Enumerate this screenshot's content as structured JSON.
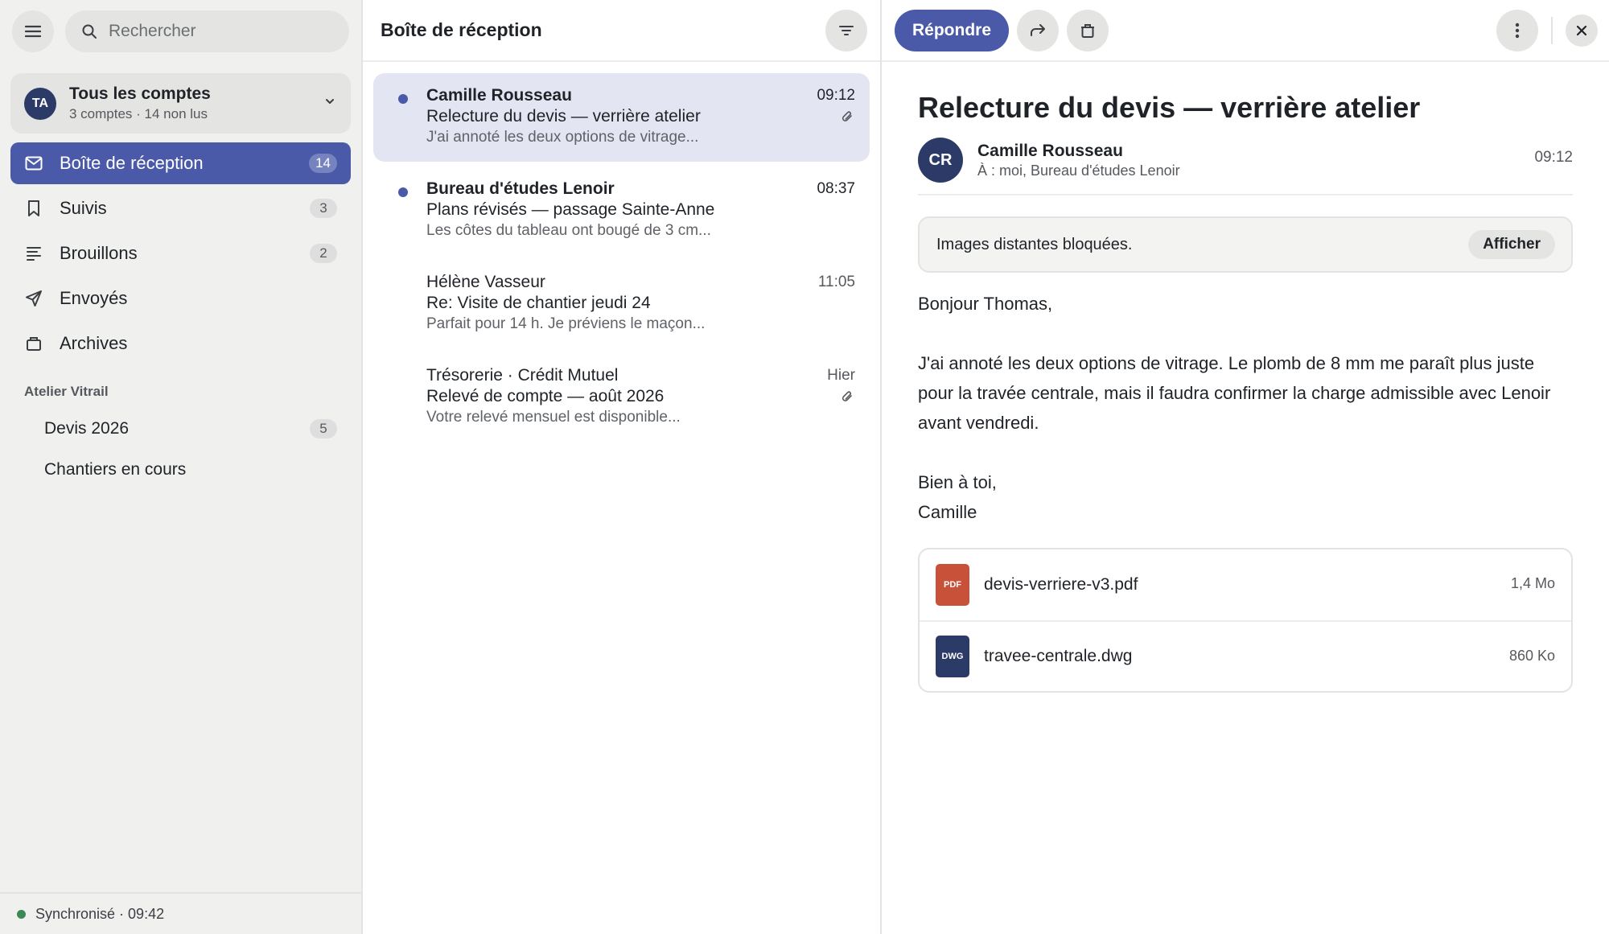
{
  "colors": {
    "accent": "#4a5aa8",
    "avatar": "#2b3a67",
    "sync_ok": "#3b8a55",
    "pdf": "#c8513a",
    "dwg": "#2b3a67"
  },
  "sidebar": {
    "search": {
      "placeholder": "Rechercher",
      "icon": "search-icon"
    },
    "menu_icon": "hamburger-icon",
    "account": {
      "initials": "TA",
      "name": "Tous les comptes",
      "subtitle": "3 comptes · 14 non lus"
    },
    "nav": [
      {
        "label": "Boîte de réception",
        "count": "14",
        "icon": "inbox-icon",
        "active": true
      },
      {
        "label": "Suivis",
        "count": "3",
        "icon": "bookmark-icon"
      },
      {
        "label": "Brouillons",
        "count": "2",
        "icon": "drafts-icon"
      },
      {
        "label": "Envoyés",
        "icon": "send-icon"
      },
      {
        "label": "Archives",
        "icon": "archive-icon"
      }
    ],
    "section_title": "Atelier Vitrail",
    "folders": [
      {
        "label": "Devis 2026",
        "count": "5"
      },
      {
        "label": "Chantiers en cours"
      }
    ],
    "status": "Synchronisé · 09:42"
  },
  "list": {
    "title": "Boîte de réception",
    "messages": [
      {
        "from": "Camille Rousseau",
        "subject": "Relecture du devis — verrière atelier",
        "preview": "J'ai annoté les deux options de vitrage...",
        "time": "09:12",
        "unread": true,
        "selected": true,
        "attachment": true
      },
      {
        "from": "Bureau d'études Lenoir",
        "subject": "Plans révisés — passage Sainte-Anne",
        "preview": "Les côtes du tableau ont bougé de 3 cm...",
        "time": "08:37",
        "unread": true,
        "attachment": false
      },
      {
        "from": "Hélène Vasseur",
        "subject": "Re: Visite de chantier jeudi 24",
        "preview": "Parfait pour 14 h. Je préviens le maçon...",
        "time": "11:05",
        "unread": false,
        "attachment": false
      },
      {
        "from": "Trésorerie · Crédit Mutuel",
        "subject": "Relevé de compte — août 2026",
        "preview": "Votre relevé mensuel est disponible...",
        "time": "Hier",
        "unread": false,
        "attachment": true
      }
    ]
  },
  "reader": {
    "toolbar": {
      "reply_label": "Répondre"
    },
    "subject": "Relecture du devis — verrière atelier",
    "sender": {
      "initials": "CR",
      "name": "Camille Rousseau",
      "to": "À : moi, Bureau d'études Lenoir",
      "time": "09:12"
    },
    "blocked_notice": "Images distantes bloquées.",
    "show_images_label": "Afficher",
    "body": {
      "greeting": "Bonjour Thomas,",
      "paragraph": "J'ai annoté les deux options de vitrage. Le plomb de 8 mm me paraît plus juste pour la travée centrale, mais il faudra confirmer la charge admissible avec Lenoir avant vendredi.",
      "closing": "Bien à toi,",
      "signature": "Camille"
    },
    "attachments": [
      {
        "type": "PDF",
        "name": "devis-verriere-v3.pdf",
        "size": "1,4 Mo"
      },
      {
        "type": "DWG",
        "name": "travee-centrale.dwg",
        "size": "860 Ko"
      }
    ]
  }
}
